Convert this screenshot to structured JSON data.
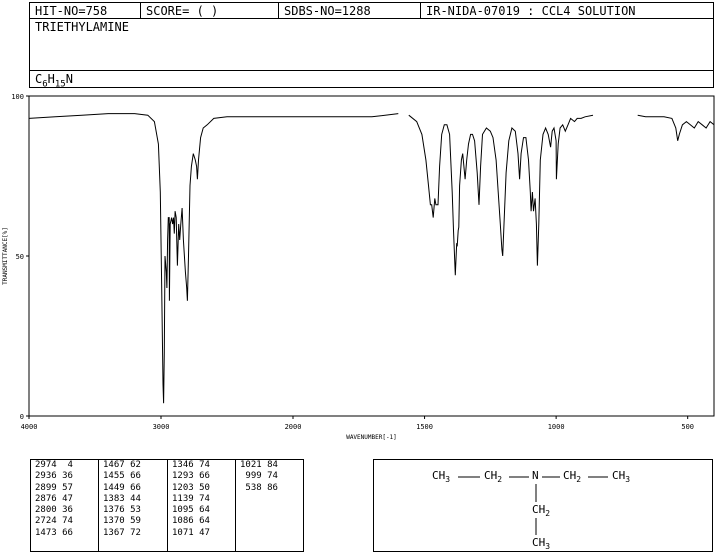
{
  "header": {
    "hit_no": "HIT-NO=758",
    "score": "SCORE= (  )",
    "sdbs_no": "SDBS-NO=1288",
    "ir_info": "IR-NIDA-07019 : CCL4 SOLUTION",
    "compound_name": "TRIETHYLAMINE",
    "formula_c": "C",
    "formula_c_sub": "6",
    "formula_h": "H",
    "formula_h_sub": "15",
    "formula_n": "N"
  },
  "chart_data": {
    "type": "line",
    "title": "",
    "xlabel": "WAVENUMBER[-1]",
    "ylabel": "TRANSMITTANCE[%]",
    "xlim": [
      4000,
      400
    ],
    "ylim": [
      0,
      100
    ],
    "x_ticks": [
      4000,
      3000,
      2000,
      1500,
      1000,
      500
    ],
    "y_ticks": [
      0,
      50,
      100
    ],
    "grid": false,
    "series": [
      {
        "segments": [
          [
            [
              4000,
              93
            ],
            [
              3800,
              93.5
            ],
            [
              3600,
              94
            ],
            [
              3400,
              94.5
            ],
            [
              3200,
              94.5
            ],
            [
              3100,
              94
            ],
            [
              3050,
              92
            ],
            [
              3020,
              85
            ],
            [
              3005,
              70
            ],
            [
              2995,
              40
            ],
            [
              2985,
              10
            ],
            [
              2980,
              4
            ],
            [
              2975,
              20
            ],
            [
              2970,
              50
            ],
            [
              2960,
              45
            ],
            [
              2955,
              40
            ],
            [
              2950,
              55
            ],
            [
              2945,
              62
            ],
            [
              2938,
              62
            ],
            [
              2936,
              36
            ],
            [
              2930,
              60
            ],
            [
              2920,
              62
            ],
            [
              2912,
              60
            ],
            [
              2905,
              62
            ],
            [
              2899,
              57
            ],
            [
              2893,
              64
            ],
            [
              2885,
              62
            ],
            [
              2876,
              47
            ],
            [
              2866,
              60
            ],
            [
              2858,
              55
            ],
            [
              2850,
              60
            ],
            [
              2840,
              65
            ],
            [
              2830,
              55
            ],
            [
              2815,
              45
            ],
            [
              2805,
              40
            ],
            [
              2800,
              36
            ],
            [
              2792,
              50
            ],
            [
              2780,
              72
            ],
            [
              2770,
              78
            ],
            [
              2755,
              82
            ],
            [
              2740,
              80
            ],
            [
              2730,
              78
            ],
            [
              2724,
              74
            ],
            [
              2716,
              80
            ],
            [
              2700,
              87
            ],
            [
              2680,
              90
            ],
            [
              2650,
              91
            ],
            [
              2600,
              93
            ],
            [
              2500,
              93.5
            ],
            [
              2300,
              93.5
            ],
            [
              2100,
              93.5
            ],
            [
              1900,
              93.5
            ],
            [
              1700,
              93.5
            ],
            [
              1600,
              94.5
            ]
          ],
          [
            [
              1560,
              94
            ],
            [
              1530,
              92
            ],
            [
              1510,
              88
            ],
            [
              1495,
              80
            ],
            [
              1485,
              72
            ],
            [
              1478,
              66
            ],
            [
              1473,
              66
            ],
            [
              1467,
              62
            ],
            [
              1461,
              68
            ],
            [
              1457,
              66
            ],
            [
              1455,
              66
            ],
            [
              1449,
              66
            ],
            [
              1443,
              78
            ],
            [
              1435,
              88
            ],
            [
              1425,
              91
            ],
            [
              1415,
              91
            ],
            [
              1405,
              88
            ],
            [
              1395,
              70
            ],
            [
              1390,
              58
            ],
            [
              1383,
              44
            ],
            [
              1378,
              54
            ],
            [
              1376,
              53
            ],
            [
              1372,
              58
            ],
            [
              1370,
              59
            ],
            [
              1367,
              72
            ],
            [
              1360,
              80
            ],
            [
              1355,
              82
            ],
            [
              1346,
              74
            ],
            [
              1340,
              80
            ],
            [
              1333,
              85
            ],
            [
              1325,
              88
            ],
            [
              1318,
              88
            ],
            [
              1310,
              86
            ],
            [
              1300,
              76
            ],
            [
              1293,
              66
            ],
            [
              1287,
              78
            ],
            [
              1280,
              88
            ],
            [
              1265,
              90
            ],
            [
              1250,
              89
            ],
            [
              1240,
              87
            ],
            [
              1228,
              80
            ],
            [
              1220,
              70
            ],
            [
              1212,
              60
            ],
            [
              1206,
              52
            ],
            [
              1203,
              50
            ],
            [
              1198,
              60
            ],
            [
              1190,
              76
            ],
            [
              1180,
              86
            ],
            [
              1168,
              90
            ],
            [
              1155,
              89
            ],
            [
              1145,
              82
            ],
            [
              1139,
              74
            ],
            [
              1133,
              82
            ],
            [
              1124,
              87
            ],
            [
              1115,
              87
            ],
            [
              1105,
              80
            ],
            [
              1098,
              70
            ],
            [
              1095,
              64
            ],
            [
              1090,
              70
            ],
            [
              1086,
              64
            ],
            [
              1080,
              68
            ],
            [
              1075,
              60
            ],
            [
              1071,
              47
            ],
            [
              1066,
              60
            ],
            [
              1060,
              80
            ],
            [
              1050,
              88
            ],
            [
              1040,
              90
            ],
            [
              1030,
              88
            ],
            [
              1021,
              84
            ],
            [
              1015,
              89
            ],
            [
              1008,
              90
            ],
            [
              1000,
              86
            ],
            [
              999,
              74
            ],
            [
              992,
              85
            ],
            [
              985,
              90
            ],
            [
              975,
              91
            ],
            [
              965,
              89
            ],
            [
              955,
              91
            ],
            [
              945,
              93
            ],
            [
              930,
              92
            ],
            [
              920,
              93
            ],
            [
              905,
              93
            ],
            [
              890,
              93.5
            ],
            [
              860,
              94
            ]
          ],
          [
            [
              690,
              94
            ],
            [
              660,
              93.5
            ],
            [
              620,
              93.5
            ],
            [
              590,
              93.5
            ],
            [
              560,
              93
            ],
            [
              545,
              90
            ],
            [
              538,
              86
            ],
            [
              532,
              88
            ],
            [
              520,
              91
            ],
            [
              505,
              92
            ],
            [
              490,
              91
            ],
            [
              475,
              90
            ],
            [
              460,
              92
            ],
            [
              445,
              91
            ],
            [
              430,
              90
            ],
            [
              415,
              92
            ],
            [
              400,
              91
            ]
          ]
        ]
      }
    ]
  },
  "peak_table": {
    "columns": [
      [
        "2974  4",
        "2936 36",
        "2899 57",
        "2876 47",
        "2800 36",
        "2724 74",
        "1473 66"
      ],
      [
        "1467 62",
        "1455 66",
        "1449 66",
        "1383 44",
        "1376 53",
        "1370 59",
        "1367 72"
      ],
      [
        "1346 74",
        "1293 66",
        "1203 50",
        "1139 74",
        "1095 64",
        "1086 64",
        "1071 47"
      ],
      [
        "1021 84",
        " 999 74",
        " 538 86"
      ]
    ]
  },
  "structure": {
    "ch3_left": "CH",
    "ch2_left": "CH",
    "n": "N",
    "ch2_right": "CH",
    "ch3_right": "CH",
    "ch2_down": "CH",
    "ch3_down": "CH",
    "sub3": "3",
    "sub2": "2"
  }
}
